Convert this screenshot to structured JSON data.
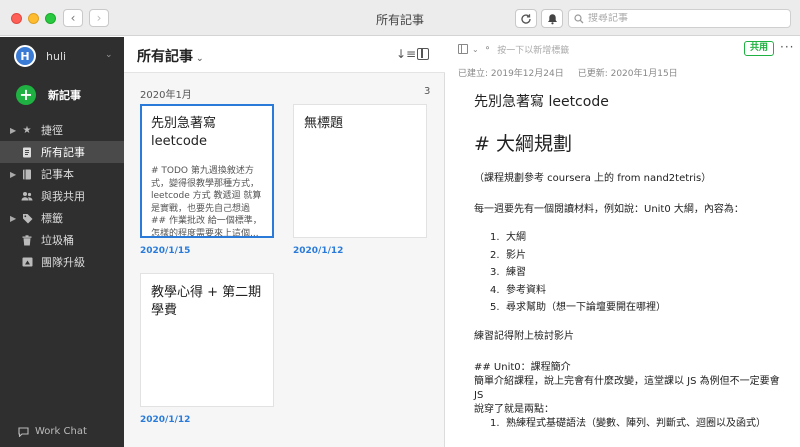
{
  "window": {
    "title": "所有記事"
  },
  "search": {
    "placeholder": "搜尋記事"
  },
  "sidebar": {
    "account": {
      "initial": "H",
      "name": "huli"
    },
    "new_note": "新記事",
    "items": [
      {
        "label": "捷徑",
        "icon": "star-icon",
        "caret": true
      },
      {
        "label": "所有記事",
        "icon": "note-icon",
        "caret": false,
        "active": true
      },
      {
        "label": "記事本",
        "icon": "notebook-icon",
        "caret": true
      },
      {
        "label": "與我共用",
        "icon": "shared-icon",
        "caret": false
      },
      {
        "label": "標籤",
        "icon": "tag-icon",
        "caret": true
      },
      {
        "label": "垃圾桶",
        "icon": "trash-icon",
        "caret": false
      },
      {
        "label": "團隊升級",
        "icon": "upgrade-icon",
        "caret": false
      }
    ],
    "work_chat": "Work Chat"
  },
  "notelist": {
    "title": "所有記事",
    "month": "2020年1月",
    "count": "3",
    "notes": [
      {
        "title": "先別急著寫 leetcode",
        "snippet": "# TODO 第九週換敘述方式，變得很教學那種方式，leetcode 方式 教遞迴 就算是實戰，也要先自己想過 ## 作業批改 給一個標準，怎樣的程度需要來上這個...",
        "date": "2020/1/15",
        "selected": true
      },
      {
        "title": "無標題",
        "snippet": "",
        "date": "2020/1/12",
        "selected": false
      },
      {
        "title": "教學心得 + 第二期學費",
        "snippet": "",
        "date": "2020/1/12",
        "selected": false
      }
    ]
  },
  "editor": {
    "tag_placeholder": "按一下以新增標籤",
    "share_label": "共用",
    "more_label": "···",
    "created": "已建立: 2019年12月24日",
    "updated": "已更新: 2020年1月15日",
    "title": "先別急著寫 leetcode",
    "h1": "# 大綱規劃",
    "p1": "（課程規劃參考 coursera 上的 from nand2tetris）",
    "p2": "每一週要先有一個閱讀材料，例如說：Unit0 大綱，內容為：",
    "list1": [
      "大綱",
      "影片",
      "練習",
      "參考資料",
      "尋求幫助（想一下論壇要開在哪裡）"
    ],
    "p3": "練習記得附上檢討影片",
    "h2": "## Unit0：課程簡介",
    "p4": "簡單介紹課程，說上完會有什麼改變，這堂課以 JS 為例但不一定要會 JS",
    "p5": "說穿了就是兩點：",
    "list2": [
      "熟練程式基礎語法（變數、陣列、判斷式、迴圈以及函式）"
    ]
  },
  "colors": {
    "accent": "#2a7bd9",
    "green": "#1fb141",
    "sidebar_bg": "#2f2f2f"
  }
}
